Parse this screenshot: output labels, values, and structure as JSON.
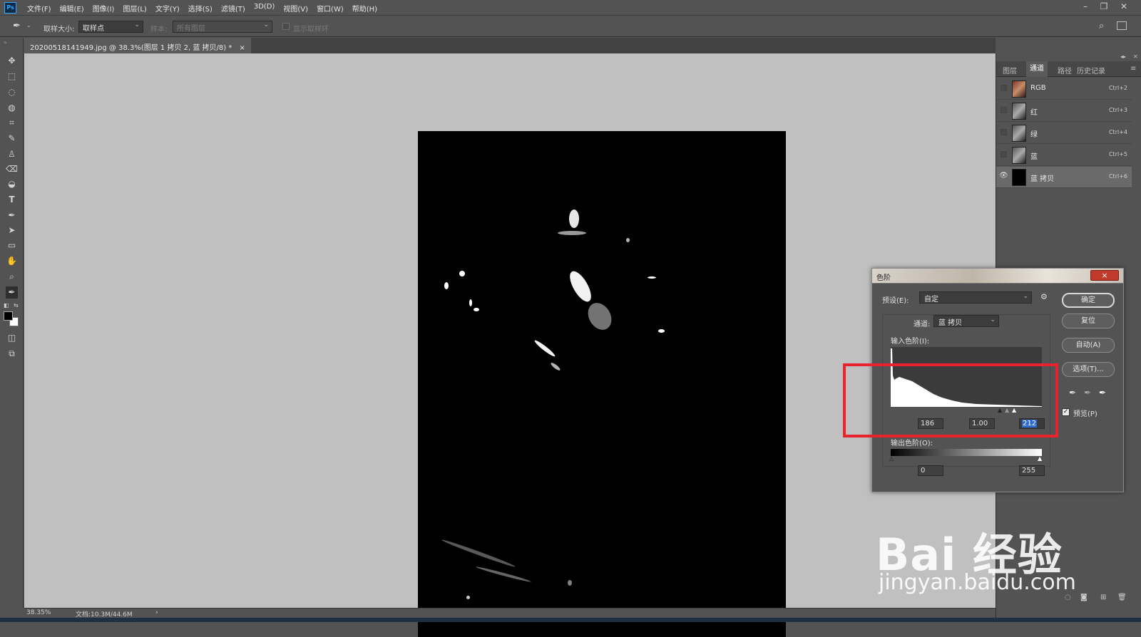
{
  "app": {
    "logo": "Ps"
  },
  "menu": [
    "文件(F)",
    "编辑(E)",
    "图像(I)",
    "图层(L)",
    "文字(Y)",
    "选择(S)",
    "滤镜(T)",
    "3D(D)",
    "视图(V)",
    "窗口(W)",
    "帮助(H)"
  ],
  "options": {
    "sample_size_label": "取样大小:",
    "sample_size_value": "取样点",
    "sample_label": "样本:",
    "sample_value": "所有图层",
    "show_ring_label": "显示取样环"
  },
  "document": {
    "tab_title": "20200518141949.jpg @ 38.3%(图层 1 拷贝 2, 蓝 拷贝/8) *",
    "close_glyph": "×"
  },
  "status": {
    "zoom": "38.35%",
    "doc_info": "文档:10.3M/44.6M",
    "arrow": "›"
  },
  "panel": {
    "tabs": [
      "图层",
      "通道",
      "路径",
      "历史记录"
    ],
    "active_tab": 1,
    "channels": [
      {
        "name": "RGB",
        "shortcut": "Ctrl+2",
        "thumb": "color",
        "visible": false
      },
      {
        "name": "红",
        "shortcut": "Ctrl+3",
        "thumb": "gray",
        "visible": false
      },
      {
        "name": "绿",
        "shortcut": "Ctrl+4",
        "thumb": "gray",
        "visible": false
      },
      {
        "name": "蓝",
        "shortcut": "Ctrl+5",
        "thumb": "gray",
        "visible": false
      },
      {
        "name": "蓝 拷贝",
        "shortcut": "Ctrl+6",
        "thumb": "black",
        "visible": true,
        "selected": true
      }
    ]
  },
  "levels_dialog": {
    "title": "色阶",
    "close_glyph": "×",
    "preset_label": "预设(E):",
    "preset_value": "自定",
    "channel_label": "通道:",
    "channel_value": "蓝 拷贝",
    "input_label": "输入色阶(I):",
    "input_black": "186",
    "input_gamma": "1.00",
    "input_white": "212",
    "output_label": "输出色阶(O):",
    "output_black": "0",
    "output_white": "255",
    "buttons": {
      "ok": "确定",
      "reset": "复位",
      "auto": "自动(A)",
      "options": "选项(T)..."
    },
    "preview_label": "预览(P)",
    "preview_checked": true
  },
  "watermark": {
    "brand": "Bai 经验",
    "url": "jingyan.baidu.com"
  },
  "colors": {
    "annotation_red": "#e8232d",
    "selection_blue": "#2d6bd1"
  }
}
